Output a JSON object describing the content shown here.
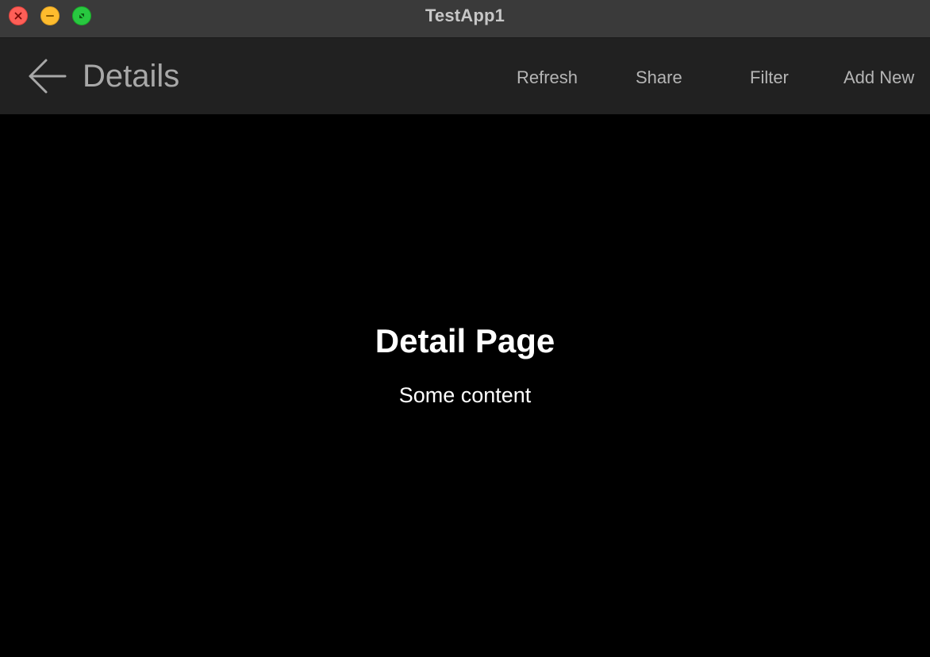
{
  "window": {
    "title": "TestApp1",
    "controls": {
      "close_color": "#fe5f57",
      "minimize_color": "#febc2e",
      "zoom_color": "#28c840"
    }
  },
  "navbar": {
    "back_icon": "arrow-left-icon",
    "title": "Details",
    "toolbar": {
      "refresh_label": "Refresh",
      "share_label": "Share",
      "filter_label": "Filter",
      "add_new_label": "Add New"
    }
  },
  "content": {
    "heading": "Detail Page",
    "body": "Some content"
  },
  "colors": {
    "titlebar_bg": "#3a3a3a",
    "navbar_bg": "#212121",
    "content_bg": "#000000",
    "text_primary": "#ffffff",
    "text_muted": "#b5b5b5"
  }
}
